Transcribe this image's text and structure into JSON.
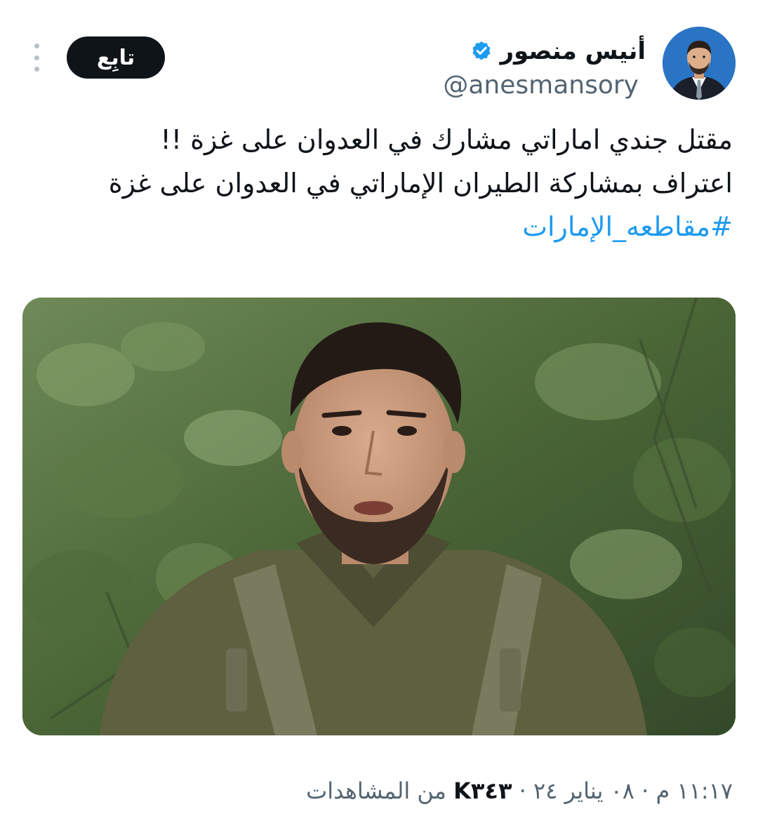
{
  "author": {
    "display_name": "أنيس منصور",
    "handle": "@anesmansory",
    "verified": true
  },
  "actions": {
    "follow_label": "تابِع"
  },
  "tweet": {
    "line1": "مقتل جندي اماراتي مشارك في العدوان على غزة !!",
    "line2": "اعتراف بمشاركة الطيران الإماراتي في العدوان على غزة",
    "hashtag": "#مقاطعه_الإمارات"
  },
  "meta": {
    "time": "١١:١٧ م",
    "date": "٠٨ يناير ٢٤",
    "views_count": "K٣٤٣",
    "views_label": "من المشاهدات",
    "separator": "·"
  },
  "colors": {
    "text": "#0f1419",
    "secondary": "#536471",
    "link": "#1d9bf0",
    "verified": "#1d9bf0",
    "button_bg": "#0f1419"
  },
  "icons": {
    "verified": "verified-badge-icon",
    "more": "more-options-icon"
  }
}
